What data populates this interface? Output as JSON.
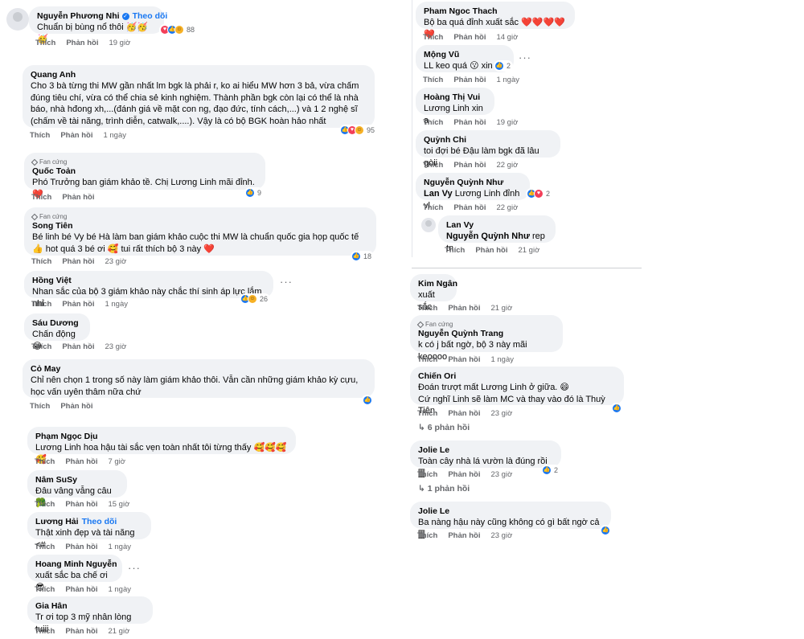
{
  "ui": {
    "like": "Thích",
    "reply": "Phản hồi",
    "follow": "Theo dõi",
    "fan_badge": "Fan cứng"
  },
  "left": [
    {
      "name": "Nguyễn Phương Nhi",
      "text": "Chuẩn bị bùng nổ thôi 🥳🥳🥳",
      "time": "19 giờ",
      "reactions": "88"
    },
    {
      "name": "Quang Anh",
      "text": "Cho 3 bà từng thi MW gần nhất lm bgk là phải r, ko ai hiểu MW hơn 3 bả, vừa chấm đúng tiêu chí, vừa có thể chia sẻ kinh nghiệm. Thành phần bgk còn lại có thể là nhà báo, nhà hđong xh,...(đánh giá về mặt con ng, đạo đức, tính cách,...) và 1 2 nghệ sĩ (chấm về tài năng, trình diễn, catwalk,....). Vậy là có bộ BGK hoàn hảo nhất",
      "time": "1 ngày",
      "reactions": "95"
    },
    {
      "name": "Quốc Toản",
      "text": "Phó Trưởng ban giám khảo tề. Chị Lương Linh mãi đỉnh. ❤️",
      "time": "",
      "reactions": "9"
    },
    {
      "name": "Song Tiên",
      "text": "Bé linh bé Vy bé Hà làm ban giám khảo cuộc thi MW là chuẩn quốc gia họp quốc tế 👍 hot quá 3 bé ơi 🥰 tui rất thích bộ 3 này ❤️",
      "time": "23 giờ",
      "reactions": "18"
    },
    {
      "name": "Hồng Việt",
      "text": "Nhan sắc của bộ 3 giám khảo này chắc thí sinh áp lực lắm nhỉ",
      "time": "1 ngày",
      "reactions": "26"
    },
    {
      "name": "Sáu Dương",
      "text": "Chấn động😂",
      "time": "23 giờ"
    },
    {
      "name": "Cỏ May",
      "text": "Chỉ nên chọn 1 trong số này làm giám khảo thôi. Vẫn cần những giám khảo kỳ cựu, học vấn uyên thâm nữa chứ",
      "time": ""
    },
    {
      "name": "Phạm Ngọc Dịu",
      "text": "Lương Linh hoa hậu tài sắc vẹn toàn nhất tôi từng thấy 🥰🥰🥰🥰",
      "time": "7 giờ"
    },
    {
      "name": "Nâm SuSy",
      "text": "Đâu vâng vẫng câu 🥦",
      "time": "15 giờ"
    },
    {
      "name": "Lương Hải",
      "text": "Thật xinh đẹp và tài năng <#",
      "time": "1 ngày"
    },
    {
      "name": "Hoang Minh Nguyễn",
      "text": "xuất sắc ba chế ơi 😎",
      "time": "1 ngày"
    },
    {
      "name": "Gia Hân",
      "text": "Tr ơi top 3 mỹ nhân lòng tuiii",
      "time": "21 giờ"
    }
  ],
  "right": [
    {
      "name": "Pham Ngoc Thach",
      "text": "Bộ ba quá đỉnh xuất sắc ❤️❤️❤️❤️❤️",
      "time": "14 giờ"
    },
    {
      "name": "Mộng Vũ",
      "text": "LL keo quá 😗 xin",
      "time": "1 ngày",
      "reactions": "2"
    },
    {
      "name": "Hoàng Thị Vui",
      "text": "Lương Linh xin ạ",
      "time": "19 giờ"
    },
    {
      "name": "Quỳnh Chi",
      "text": "toi đợi bé Đậu làm bgk đã lâu gòii",
      "time": "22 giờ"
    },
    {
      "name": "Nguyễn Quỳnh Như",
      "mention": "Lan Vy",
      "text": " Lương Linh đỉnh vl",
      "time": "22 giờ",
      "reactions": "2"
    },
    {
      "name": "Lan Vy",
      "mention": "Nguyễn Quỳnh Như",
      "text": " rep tn",
      "time": "21 giờ"
    },
    {
      "name": "Kim Ngân",
      "text": "xuất sắc",
      "time": "21 giờ"
    },
    {
      "name": "Nguyễn Quỳnh Trang",
      "text": "k có j bất ngờ, bộ 3 này mãi keoooo",
      "time": "1 ngày"
    },
    {
      "name": "Chiến Ori",
      "text": "Đoán trượt mất Lương Linh ở giữa. 😄",
      "text2": "Cứ nghĩ Linh sẽ làm MC và thay vào đó là Thuỳ Tiên.",
      "time": "23 giờ",
      "replies": "6 phản hồi"
    },
    {
      "name": "Jolie Le",
      "text": "Toàn cây nhà lá vườn là đúng rồi 🀫",
      "time": "23 giờ",
      "reactions": "2",
      "replies": "1 phản hồi"
    },
    {
      "name": "Jolie Le",
      "text": "Ba nàng hậu này cũng không có gì bất ngờ cả🀫",
      "time": "23 giờ"
    }
  ]
}
